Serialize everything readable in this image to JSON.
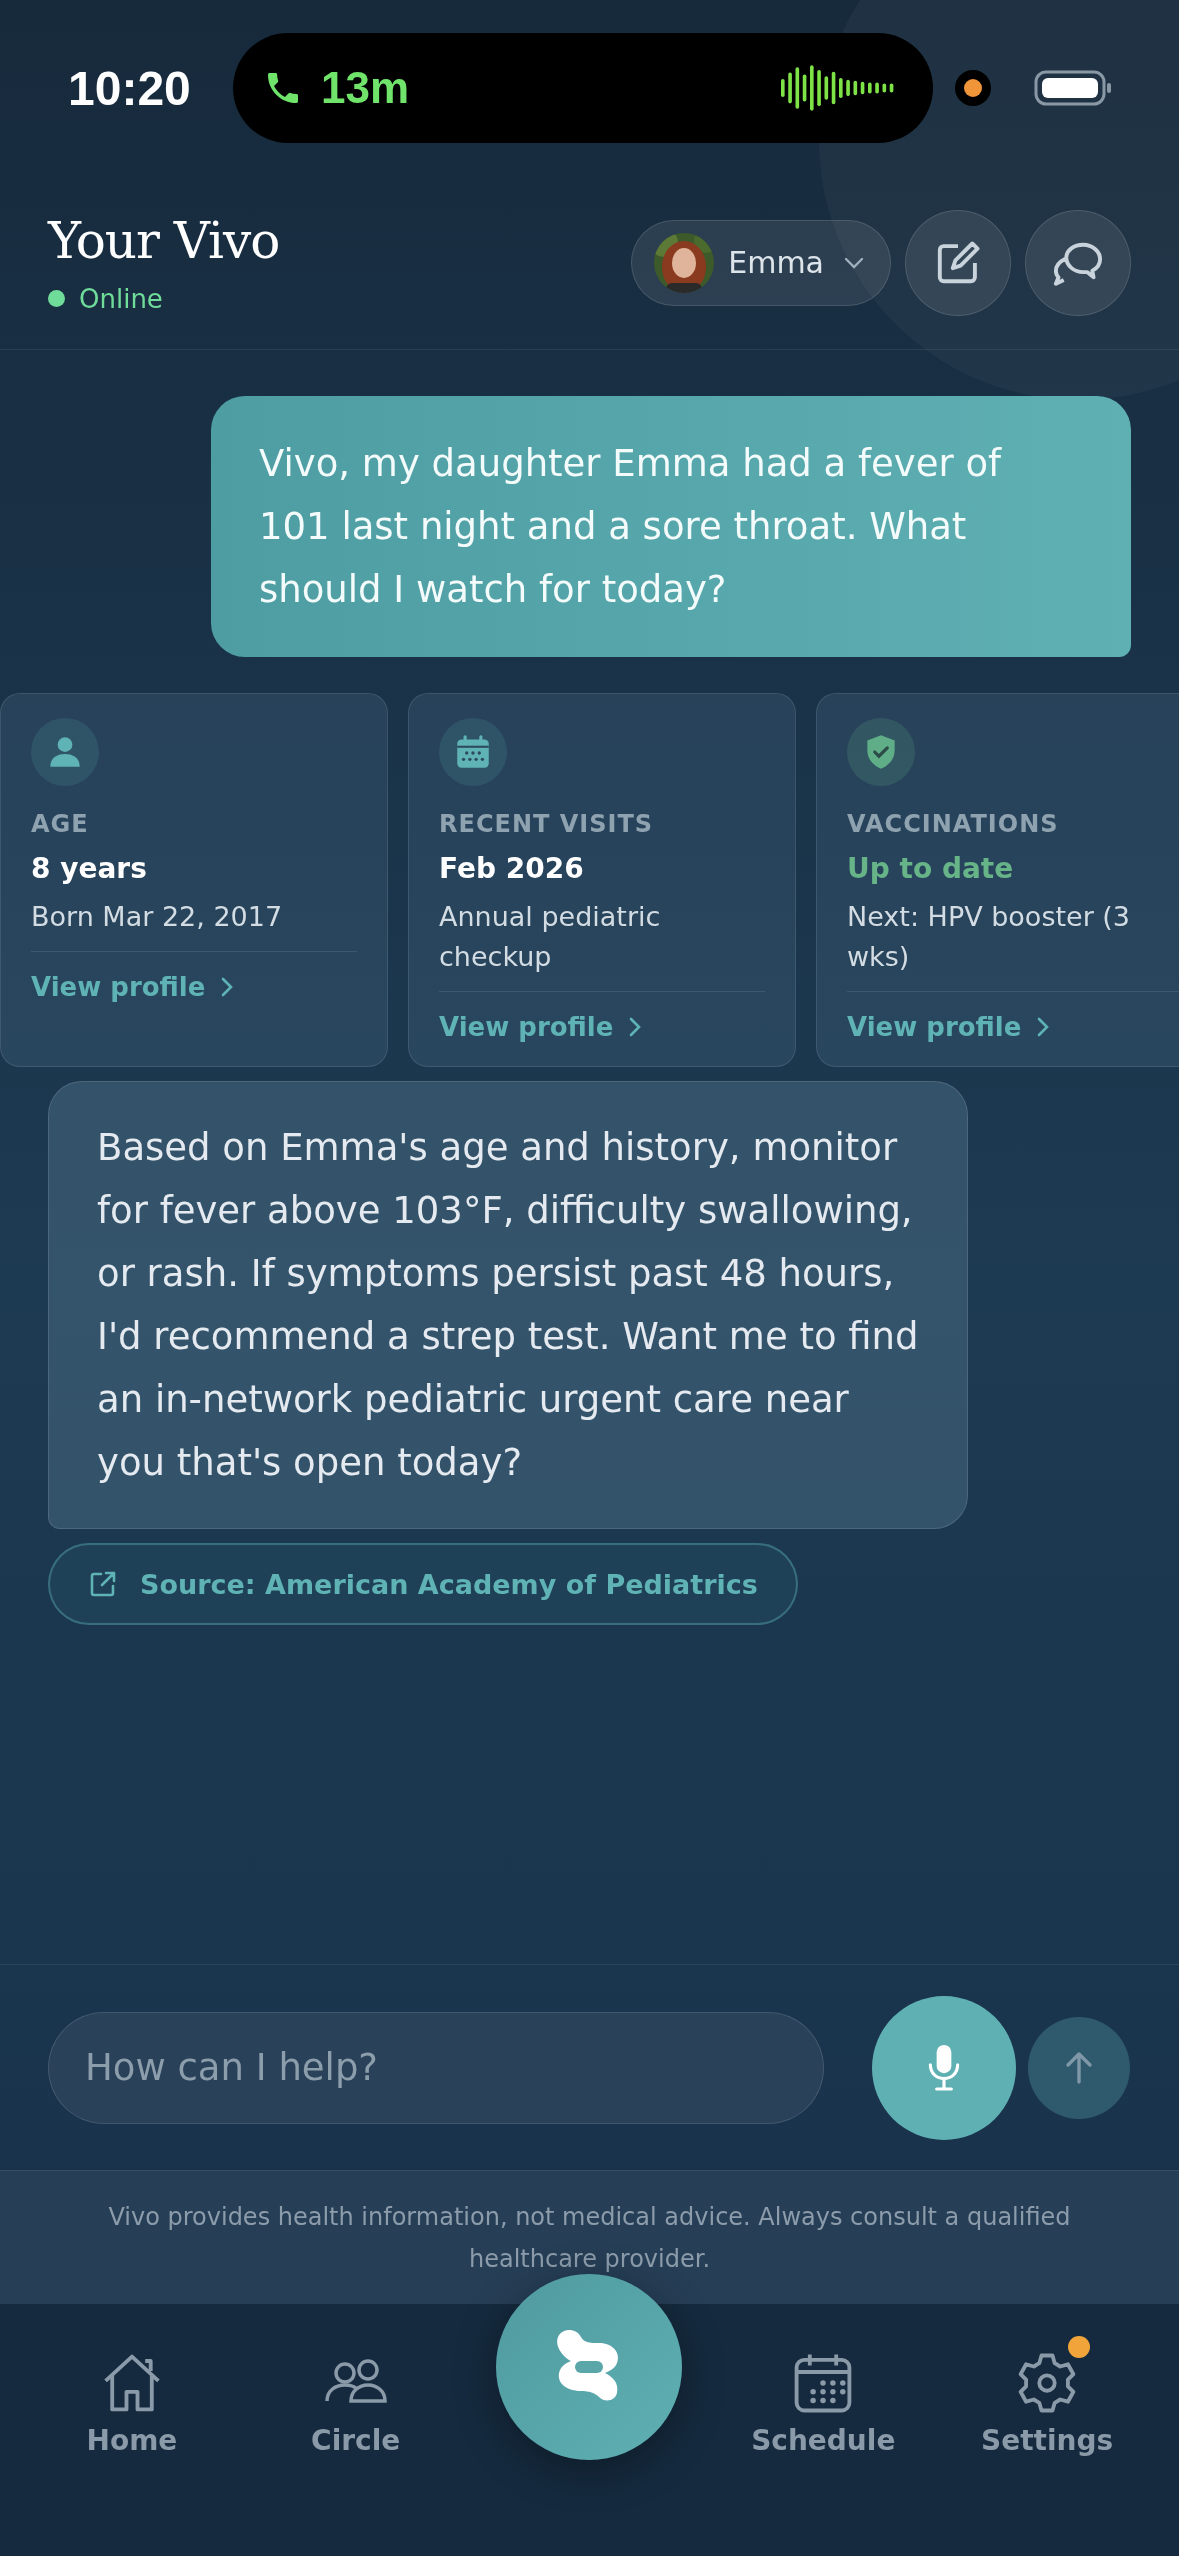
{
  "status_bar": {
    "time": "10:20",
    "call_duration": "13m"
  },
  "header": {
    "title": "Your Vivo",
    "status": "Online",
    "online": true
  },
  "profile_switcher": {
    "name": "Emma"
  },
  "messages": [
    {
      "kind": "user",
      "text": "Vivo, my daughter Emma had a fever of 101 last night and a sore throat. What should I watch for today?"
    },
    {
      "kind": "cards"
    },
    {
      "kind": "assistant",
      "text": "Based on Emma's age and history, monitor for fever above 103°F, difficulty swallowing, or rash. If symptoms persist past 48 hours, I'd recommend a strep test. Want me to find an in-network pediatric urgent care near you that's open today?"
    },
    {
      "kind": "source",
      "text": "Source: American Academy of Pediatrics"
    }
  ],
  "cards": [
    {
      "kind": "person",
      "label": "AGE",
      "value": "8 years",
      "highlight": false,
      "detail": "Born Mar 22, 2017",
      "link": "View profile"
    },
    {
      "kind": "calendar",
      "label": "RECENT VISITS",
      "value": "Feb 2026",
      "highlight": false,
      "detail": "Annual pediatric checkup",
      "link": "View profile"
    },
    {
      "kind": "shield",
      "label": "VACCINATIONS",
      "value": "Up to date",
      "highlight": true,
      "detail": "Next: HPV booster (3 wks)",
      "link": "View profile"
    }
  ],
  "composer": {
    "placeholder": "How can I help?"
  },
  "disclaimer": "Vivo provides health information, not medical advice. Always consult a qualified healthcare provider.",
  "nav": [
    {
      "kind": "home",
      "label": "Home",
      "badge": false
    },
    {
      "kind": "circle",
      "label": "Circle",
      "badge": false
    },
    {
      "kind": "logo"
    },
    {
      "kind": "schedule",
      "label": "Schedule",
      "badge": false
    },
    {
      "kind": "settings",
      "label": "Settings",
      "badge": true
    }
  ]
}
